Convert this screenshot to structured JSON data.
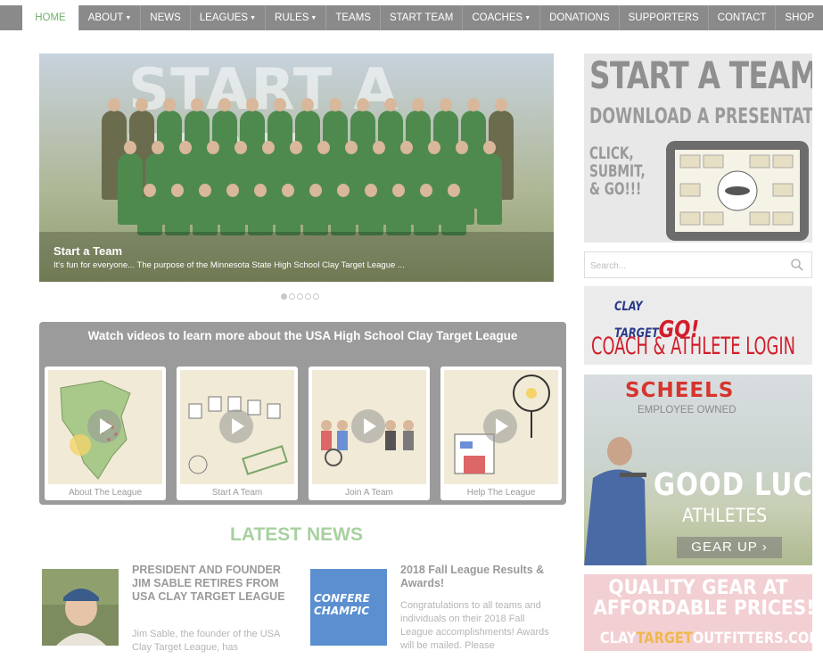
{
  "nav": {
    "items": [
      {
        "label": "HOME",
        "dropdown": false,
        "active": true
      },
      {
        "label": "ABOUT",
        "dropdown": true
      },
      {
        "label": "NEWS",
        "dropdown": false
      },
      {
        "label": "LEAGUES",
        "dropdown": true
      },
      {
        "label": "RULES",
        "dropdown": true
      },
      {
        "label": "TEAMS",
        "dropdown": false
      },
      {
        "label": "START TEAM",
        "dropdown": false
      },
      {
        "label": "COACHES",
        "dropdown": true
      },
      {
        "label": "DONATIONS",
        "dropdown": false
      },
      {
        "label": "SUPPORTERS",
        "dropdown": false
      },
      {
        "label": "CONTACT",
        "dropdown": false
      },
      {
        "label": "SHOP",
        "dropdown": false
      }
    ]
  },
  "hero": {
    "overlay_text": "START A TEAM",
    "caption_title": "Start a Team",
    "caption_text": "It's fun for everyone... The purpose of the Minnesota State High School Clay Target League ...",
    "slide_count": 5,
    "active_slide": 1
  },
  "videos": {
    "title": "Watch videos to learn more about the USA High School Clay Target League",
    "items": [
      {
        "label": "About The League"
      },
      {
        "label": "Start A Team"
      },
      {
        "label": "Join A Team"
      },
      {
        "label": "Help The League"
      }
    ]
  },
  "news": {
    "heading": "LATEST NEWS",
    "items": [
      {
        "title": "PRESIDENT AND FOUNDER JIM SABLE RETIRES FROM USA CLAY TARGET LEAGUE",
        "body": "Jim Sable, the founder of the USA Clay Target League, has"
      },
      {
        "title": "2018 Fall League Results & Awards!",
        "body": "Congratulations to all teams and individuals on their 2018 Fall League accomplishments! Awards will be mailed. Please",
        "image_text": "CONFERE CHAMPIC"
      }
    ]
  },
  "sidebar": {
    "ad1": {
      "headline": "START A TEAM!",
      "subline": "DOWNLOAD A PRESENTATION",
      "cta": [
        "CLICK,",
        "SUBMIT,",
        "& GO!!!"
      ]
    },
    "search": {
      "placeholder": "Search..."
    },
    "ad2": {
      "logo_top": "CLAY",
      "logo_bottom": "TARGET",
      "logo_go": "GO!",
      "login": "COACH & ATHLETE LOGIN"
    },
    "ad3": {
      "brand": "SCHEELS",
      "tagline": "EMPLOYEE OWNED",
      "line1": "GOOD LUCK",
      "line2": "ATHLETES",
      "button": "GEAR UP ›"
    },
    "ad4": {
      "line1": "QUALITY GEAR AT",
      "line2": "AFFORDABLE PRICES!",
      "url_start": "CLAY",
      "url_mid": "TARGET",
      "url_end": "OUTFITTERS.COM"
    }
  },
  "colors": {
    "nav_bg": "#8a8a8a",
    "accent_green": "#6fb46f",
    "news_heading": "#a8d0a0",
    "brand_red": "#d11d2b",
    "brand_blue": "#2a3a87"
  }
}
